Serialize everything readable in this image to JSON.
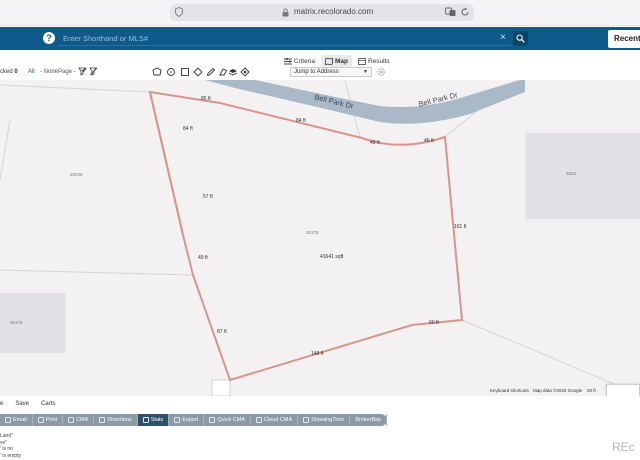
{
  "browser": {
    "url": "matrix.recolorado.com"
  },
  "header": {
    "help_label": "?",
    "search_placeholder": "Enter Shorthand or MLS#",
    "clear_label": "×",
    "recent_label": "Recent S"
  },
  "tabs": [
    {
      "label": "Criteria",
      "icon": "criteria-icon"
    },
    {
      "label": "Map",
      "icon": "map-icon"
    },
    {
      "label": "Results",
      "icon": "results-icon"
    }
  ],
  "toolbar": {
    "checked_label": "cked",
    "checked_count": "0",
    "all_label": "All",
    "none_label": "- None -",
    "page_label": "Page -",
    "jump_label": "Jump to Address"
  },
  "map": {
    "road_labels": [
      "Bell Park Dr",
      "Bell Park Dr"
    ],
    "parcel_numbers": [
      "20246",
      "26178",
      "26176",
      "5533"
    ],
    "dimensions": [
      "85 ft",
      "84 ft",
      "84 ft",
      "57 ft",
      "49 ft",
      "46 ft",
      "161 ft",
      "49 ft",
      "87 ft",
      "60 ft",
      "148 ft"
    ],
    "area_label": "41641 sqft",
    "attribution": [
      "Keyboard shortcuts",
      "Map data ©2025 Google",
      "20 ft"
    ]
  },
  "bottom": {
    "subtabs": [
      "e",
      "Save",
      "Carts"
    ],
    "actions": [
      "Email",
      "Print",
      "CMA",
      "Directions",
      "Stats",
      "Export",
      "Quick CMA",
      "Cloud CMA",
      "ShowingTime",
      "BrokerBay"
    ],
    "active_action": "Stats",
    "notes": [
      "Land\"",
      "ve\"",
      "' is no",
      "' is empty"
    ],
    "brand": "REc"
  },
  "colors": {
    "header_bg": "#0e5a8a",
    "road": "#a9b9c8",
    "parcel_line": "#d9958c",
    "building": "#e0e2e8",
    "action_active": "#2f4f66"
  }
}
